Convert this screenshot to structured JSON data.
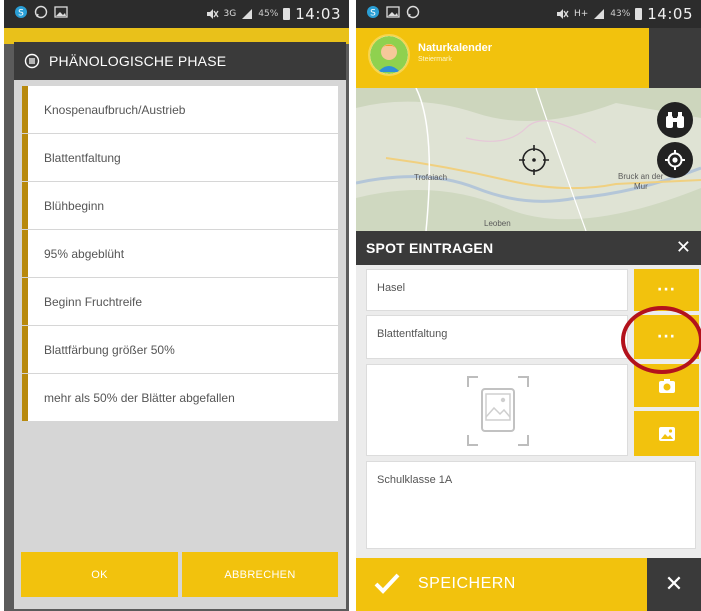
{
  "left_screen": {
    "status_bar": {
      "network": "3G",
      "battery_percent": "45%",
      "time": "14:03"
    },
    "dialog_title": "PHÄNOLOGISCHE PHASE",
    "phases": [
      {
        "label": "Knospenaufbruch/Austrieb"
      },
      {
        "label": "Blattentfaltung"
      },
      {
        "label": "Blühbeginn"
      },
      {
        "label": "95% abgeblüht"
      },
      {
        "label": "Beginn Fruchtreife"
      },
      {
        "label": "Blattfärbung größer 50%"
      },
      {
        "label": "mehr als 50% der Blätter abgefallen"
      }
    ],
    "ok_label": "OK",
    "cancel_label": "ABBRECHEN"
  },
  "right_screen": {
    "status_bar": {
      "network": "H+",
      "battery_percent": "43%",
      "time": "14:05"
    },
    "app_title": "Naturkalender",
    "app_subtitle": "Steiermark",
    "map_labels": {
      "town_1": "Trofaiach",
      "town_2": "Bruck an der",
      "town_2b": "Mur",
      "town_3": "Leoben"
    },
    "spot_title": "SPOT EINTRAGEN",
    "close_symbol": "✕",
    "species_value": "Hasel",
    "phase_value": "Blattentfaltung",
    "note_value": "Schulklasse 1A",
    "more_symbol": "···",
    "save_label": "SPEICHERN"
  },
  "colors": {
    "accent_yellow": "#f2c20d",
    "phase_marker": "#b88a0e",
    "dark_bar": "#3a3a3a",
    "highlight_ring": "#b3121c"
  }
}
